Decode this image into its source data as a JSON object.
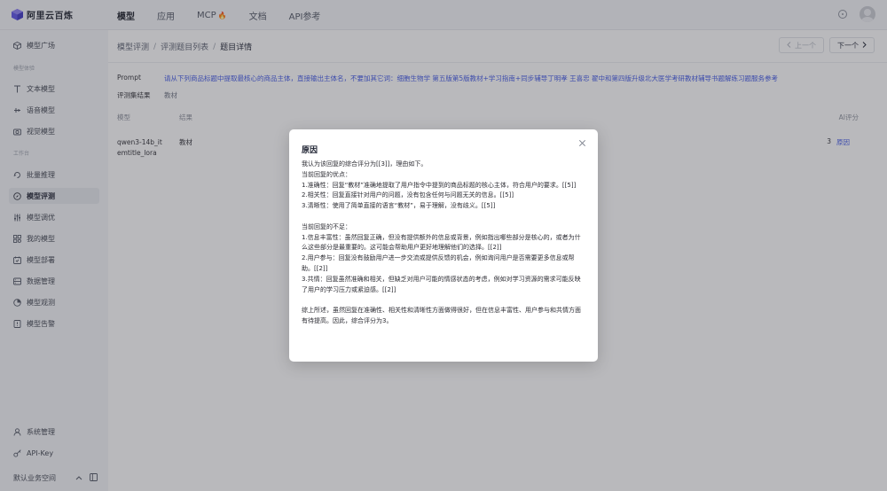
{
  "brand": {
    "name": "阿里云百炼"
  },
  "topnav": {
    "items": [
      {
        "label": "模型"
      },
      {
        "label": "应用"
      },
      {
        "label": "MCP"
      },
      {
        "label": "文档"
      },
      {
        "label": "API参考"
      }
    ]
  },
  "sidebar": {
    "top_item": "模型广场",
    "section1": "模型体验",
    "exp_items": [
      {
        "label": "文本模型"
      },
      {
        "label": "语音模型"
      },
      {
        "label": "视觉模型"
      }
    ],
    "section2": "工作台",
    "work_items": [
      {
        "label": "批量推理"
      },
      {
        "label": "模型评测"
      },
      {
        "label": "模型调优"
      },
      {
        "label": "我的模型"
      },
      {
        "label": "模型部署"
      },
      {
        "label": "数据管理"
      },
      {
        "label": "模型观测"
      },
      {
        "label": "模型告警"
      }
    ],
    "bottom_items": [
      {
        "label": "系统管理"
      },
      {
        "label": "API-Key"
      }
    ],
    "workspace": "默认业务空间"
  },
  "breadcrumb": {
    "items": [
      "模型评测",
      "评测题目列表",
      "题目详情"
    ]
  },
  "pager": {
    "prev": "上一个",
    "next": "下一个"
  },
  "detail": {
    "prompt_label": "Prompt",
    "prompt_text": "请从下列商品标题中提取最核心的商品主体，直接输出主体名，不要加其它词：细胞生物学 第五版第5版教材+学习指南+同步辅导丁明孝 王喜忠 翟中和第四版升级北大医学考研教材辅导书题解练习题服务参考",
    "result_label": "评测集结果",
    "result_value": "教材"
  },
  "table": {
    "headers": {
      "model": "模型",
      "result": "结果",
      "score": "AI评分"
    },
    "row": {
      "model": "qwen3-14b_itemtitle_lora",
      "result": "教材",
      "score": "3",
      "reason": "原因"
    }
  },
  "modal": {
    "title": "原因",
    "lines": [
      "我认为该回复的综合评分为[[3]]，理由如下。",
      "当前回复的优点：",
      "1.准确性：回复“教材”准确地提取了用户指令中提到的商品标题的核心主体，符合用户的要求。[[5]]",
      "2.相关性：回复直接针对用户的问题，没有包含任何与问题无关的信息。[[5]]",
      "3.清晰性：使用了简单直接的语言“教材”，易于理解，没有歧义。[[5]]",
      "",
      "当前回复的不足：",
      "1.信息丰富性：虽然回复正确，但没有提供额外的信息或背景，例如指出哪些部分是核心的，或者为什么这些部分是最重要的。这可能会帮助用户更好地理解他们的选择。[[2]]",
      "2.用户参与：回复没有鼓励用户进一步交流或提供反馈的机会，例如询问用户是否需要更多信息或帮助。[[2]]",
      "3.共情：回复虽然准确和相关，但缺乏对用户可能的情感状态的考虑，例如对学习资源的需求可能反映了用户的学习压力或紧迫感。[[2]]",
      "",
      "综上所述，虽然回复在准确性、相关性和清晰性方面做得很好，但在信息丰富性、用户参与和共情方面有待提高。因此，综合评分为3。"
    ]
  }
}
